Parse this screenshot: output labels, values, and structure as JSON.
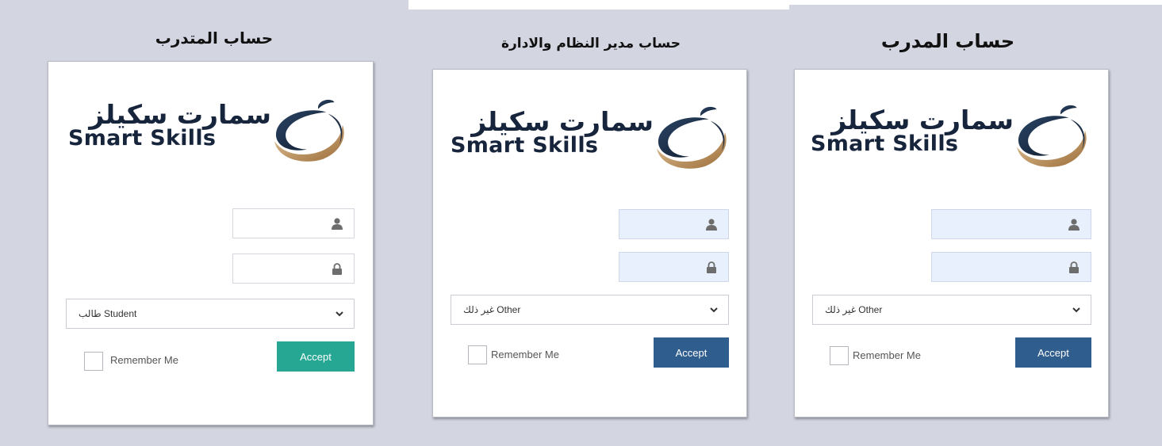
{
  "panels": [
    {
      "title": "حساب المتدرب",
      "logo": {
        "arabic": "سمارت سكيلز",
        "english": "Smart Skills"
      },
      "username": {
        "value": "",
        "icon": "user-icon",
        "filled": false
      },
      "password": {
        "value": "",
        "icon": "lock-icon",
        "filled": false
      },
      "role_select": {
        "value": "طالب Student",
        "icon": "chevron-down-icon"
      },
      "remember_label": "Remember Me",
      "accept_label": "Accept",
      "accept_color": "#25a793"
    },
    {
      "title": "حساب مدير النظام والادارة",
      "logo": {
        "arabic": "سمارت سكيلز",
        "english": "Smart Skills"
      },
      "username": {
        "value": "",
        "icon": "user-icon",
        "filled": true
      },
      "password": {
        "value": "",
        "icon": "lock-icon",
        "filled": true
      },
      "role_select": {
        "value": "غير ذلك Other",
        "icon": "chevron-down-icon"
      },
      "remember_label": "Remember Me",
      "accept_label": "Accept",
      "accept_color": "#2f5d8e"
    },
    {
      "title": "حساب المدرب",
      "logo": {
        "arabic": "سمارت سكيلز",
        "english": "Smart Skills"
      },
      "username": {
        "value": "",
        "icon": "user-icon",
        "filled": true
      },
      "password": {
        "value": "",
        "icon": "lock-icon",
        "filled": true
      },
      "role_select": {
        "value": "غير ذلك Other",
        "icon": "chevron-down-icon"
      },
      "remember_label": "Remember Me",
      "accept_label": "Accept",
      "accept_color": "#2f5d8e"
    }
  ],
  "colors": {
    "background": "#d3d6e0",
    "logo_text": "#16243c",
    "logo_gold": "#c79a63",
    "field_fill": "#e8f0fe"
  }
}
